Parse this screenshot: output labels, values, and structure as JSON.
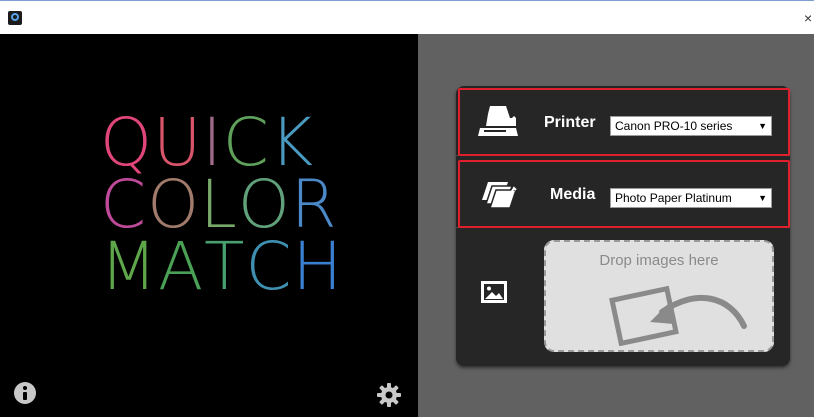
{
  "window": {
    "close_glyph": "×"
  },
  "logo": {
    "line1": [
      "Q",
      "U",
      "I",
      "C",
      "K"
    ],
    "line2": [
      "C",
      "O",
      "L",
      "O",
      "R"
    ],
    "line3": [
      "M",
      "A",
      "T",
      "C",
      "H"
    ],
    "colors": {
      "line1": [
        "#e0467a",
        "#d9556b",
        "#a06a8a",
        "#5fa05a",
        "#4a9ac0"
      ],
      "line2": [
        "#c04a9a",
        "#a07a6a",
        "#78a86a",
        "#60a07a",
        "#4a88c8"
      ],
      "line3": [
        "#5ea64a",
        "#4aa055",
        "#48a070",
        "#3f90b0",
        "#3a7fd0"
      ]
    }
  },
  "printer": {
    "label": "Printer",
    "selected": "Canon PRO-10 series"
  },
  "media": {
    "label": "Media",
    "selected": "Photo Paper Platinum"
  },
  "drop": {
    "text": "Drop images here"
  },
  "colors": {
    "highlight": "#e0202c",
    "left_bg": "#000000",
    "right_bg": "#616161",
    "card_bg": "#262626"
  },
  "icons": [
    "app-icon",
    "close-icon",
    "info-icon",
    "gear-icon",
    "printer-icon",
    "media-icon",
    "image-icon",
    "caret-down-icon"
  ]
}
